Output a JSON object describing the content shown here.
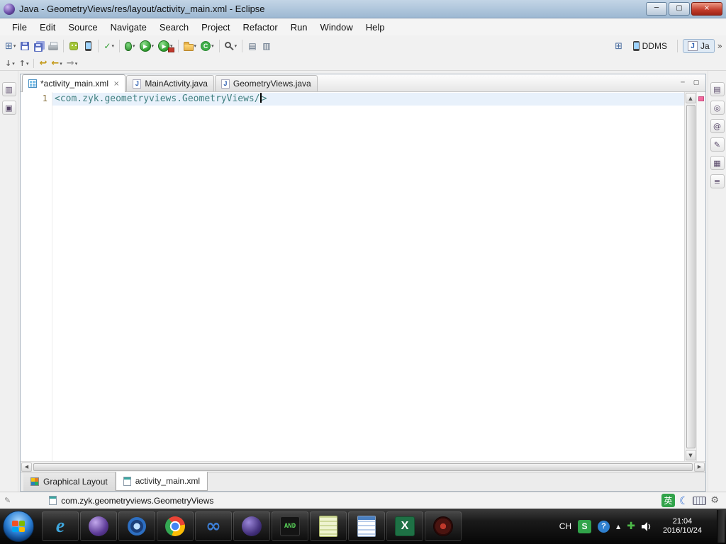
{
  "colors": {
    "titlebar_blue": "#9db8d2",
    "close_red": "#c23b2a",
    "code_tag_teal": "#3f7f7f",
    "current_line_blue": "#e8f1fb",
    "overview_marker_pink": "#f26a9e",
    "taskbar_black": "#060606",
    "run_green": "#2f9e2f"
  },
  "icons": {
    "minimize": "─",
    "maximize": "▢",
    "close": "×",
    "dropdown": "▾",
    "tab_close": "×",
    "new_wizard": "⊞",
    "check": "✓",
    "run": "▶",
    "open_type": "▤",
    "open_task": "▥",
    "next_annotation": "↓",
    "prev_annotation": "↑",
    "last_edit": "↩",
    "back": "←",
    "forward": "→",
    "open_perspective": "⊞",
    "overflow": "»",
    "scroll_up": "▲",
    "scroll_down": "▼",
    "scroll_left": "◀",
    "scroll_right": "▶",
    "pencil": "✎",
    "moon": "☾",
    "wrench": "⚙",
    "hidden_tray": "▲",
    "green_plus": "✚"
  },
  "window": {
    "title": "Java - GeometryViews/res/layout/activity_main.xml - Eclipse"
  },
  "menu": {
    "items": [
      "File",
      "Edit",
      "Source",
      "Navigate",
      "Search",
      "Project",
      "Refactor",
      "Run",
      "Window",
      "Help"
    ]
  },
  "toolbar": {
    "buttons": [
      {
        "name": "new-wizard"
      },
      {
        "name": "save"
      },
      {
        "name": "save-all"
      },
      {
        "name": "print"
      },
      {
        "name": "sdk-manager"
      },
      {
        "name": "avd-manager"
      },
      {
        "name": "mark-occurrences"
      },
      {
        "name": "debug"
      },
      {
        "name": "run"
      },
      {
        "name": "run-external-tools"
      },
      {
        "name": "new-java-project"
      },
      {
        "name": "new-class",
        "glyph": "C"
      },
      {
        "name": "search"
      },
      {
        "name": "open-type"
      },
      {
        "name": "open-task"
      }
    ],
    "perspectives": {
      "ddms_label": "DDMS",
      "java_label": "Ja",
      "java_icon": "J"
    }
  },
  "editor_tabs": [
    {
      "label": "*activity_main.xml"
    },
    {
      "label": "MainActivity.java",
      "icon": "J"
    },
    {
      "label": "GeometryViews.java",
      "icon": "J"
    }
  ],
  "editor": {
    "line_number": "1",
    "code_before_cursor": "<com.zyk.geometryviews.GeometryViews/",
    "code_after_cursor": ">"
  },
  "left_trim": {
    "items": [
      {
        "name": "fast-view-package-explorer",
        "glyph": "▥"
      },
      {
        "name": "fast-view-hierarchy",
        "glyph": "▣"
      }
    ]
  },
  "right_trim": {
    "items": [
      {
        "name": "problems-view",
        "glyph": "▤"
      },
      {
        "name": "search-view",
        "glyph": "◎"
      },
      {
        "name": "javadoc-view",
        "glyph": "@"
      },
      {
        "name": "declaration-view",
        "glyph": "✎"
      },
      {
        "name": "palette-view",
        "glyph": "▦"
      },
      {
        "name": "properties-view",
        "glyph": "≡"
      }
    ]
  },
  "bottom_tabs": [
    {
      "label": "Graphical Layout"
    },
    {
      "label": "activity_main.xml"
    }
  ],
  "status_bar": {
    "text": "com.zyk.geometryviews.GeometryViews",
    "ime_mode": "英"
  },
  "taskbar": {
    "icons": [
      {
        "name": "internet-explorer",
        "glyph": "e"
      },
      {
        "name": "eclipse-purple-orb",
        "glyph": ""
      },
      {
        "name": "blue-ring-tool",
        "glyph": ""
      },
      {
        "name": "chrome",
        "glyph": ""
      },
      {
        "name": "blue-infinity-tool",
        "glyph": "∞"
      },
      {
        "name": "purple-orb-tool",
        "glyph": ""
      },
      {
        "name": "android-tool",
        "glyph": "AND"
      },
      {
        "name": "notepad-green",
        "glyph": ""
      },
      {
        "name": "notepad-blue",
        "glyph": ""
      },
      {
        "name": "excel",
        "glyph": "X"
      },
      {
        "name": "screen-recorder",
        "glyph": ""
      }
    ],
    "tray": {
      "lang": "CH",
      "sogou": "S",
      "help": "?",
      "time": "21:04",
      "date": "2016/10/24"
    }
  }
}
